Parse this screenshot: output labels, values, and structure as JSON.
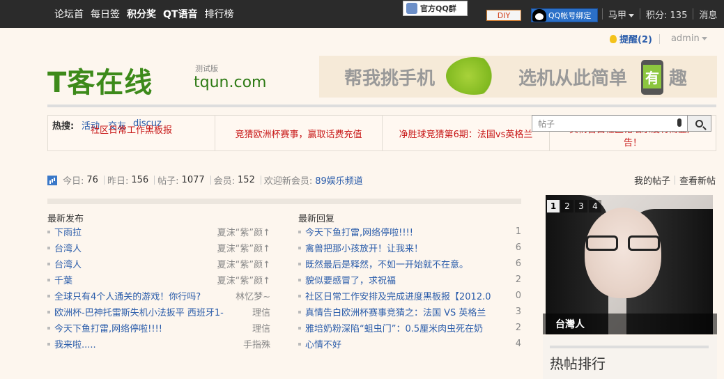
{
  "topnav": {
    "items": [
      {
        "label": "论坛首",
        "bold": false
      },
      {
        "label": "每日签",
        "bold": false
      },
      {
        "label": "积分奖",
        "bold": true
      },
      {
        "label": "QT语音",
        "bold": true
      },
      {
        "label": "排行榜",
        "bold": false
      }
    ],
    "qq_group": "官方QQ群",
    "diy": "DIY",
    "qq_bind": "QQ帐号绑定",
    "user": "马甲",
    "points_label": "积分: 135",
    "messages": "消息"
  },
  "remind": {
    "label": "提醒",
    "count": "(2)",
    "admin": "admin"
  },
  "logo": {
    "main": "T客在线",
    "beta": "测试版",
    "domain": "tqun.com"
  },
  "banner": {
    "left": "帮我挑手机",
    "right": "选机从此简单",
    "highlight": "有",
    "end": "趣"
  },
  "hotbar": {
    "label": "热搜:",
    "keywords": [
      "活动",
      "交友",
      "discuz"
    ],
    "cells": [
      "社区日常工作黑板报",
      "竞猜欧洲杯赛事，赢取话费充值",
      "净胜球竞猜第6期：法国vs英格兰",
      "真情告白社区论坛永没有商业广告！"
    ],
    "search_placeholder": "帖子"
  },
  "stats": {
    "today_label": "今日:",
    "today": "76",
    "yesterday_label": "昨日:",
    "yesterday": "156",
    "posts_label": "帖子:",
    "posts": "1077",
    "members_label": "会员:",
    "members": "152",
    "welcome_label": "欢迎新会员:",
    "newest": "89娱乐频道",
    "my_posts": "我的帖子",
    "new_posts": "查看新帖"
  },
  "latest": {
    "title": "最新发布",
    "items": [
      {
        "title": "下雨拉",
        "author": "夏沫“紫”颜↑"
      },
      {
        "title": "台湾人",
        "author": "夏沫“紫”颜↑"
      },
      {
        "title": "台湾人",
        "author": "夏沫“紫”颜↑"
      },
      {
        "title": "千葉",
        "author": "夏沫“紫”颜↑"
      },
      {
        "title": "全球只有4个人通关的游戏！你行吗?",
        "author": "林忆梦~"
      },
      {
        "title": "欧洲杯-巴神托雷斯失机小法扳平 西班牙1-",
        "author": "理信"
      },
      {
        "title": "今天下鱼打雷,网络停啦!!!!",
        "author": "理信"
      },
      {
        "title": "我来啦.....",
        "author": "手指殊"
      }
    ]
  },
  "replies": {
    "title": "最新回复",
    "items": [
      {
        "title": "今天下鱼打雷,网络停啦!!!!",
        "count": "1"
      },
      {
        "title": "禽兽把那小孩放开！让我来！",
        "count": "6"
      },
      {
        "title": "既然最后是释然，不如一开始就不在意。",
        "count": "6"
      },
      {
        "title": "貌似要感冒了，求祝福",
        "count": "2"
      },
      {
        "title": "社区日常工作安排及完成进度黑板报【2012.0",
        "count": "0"
      },
      {
        "title": "真情告白欧洲杯赛事竞猜之：法国 VS 英格兰",
        "count": "3"
      },
      {
        "title": "雅培奶粉深陷“蛆虫门”：0.5厘米肉虫死在奶",
        "count": "2"
      },
      {
        "title": "心情不好",
        "count": "4"
      }
    ]
  },
  "slider": {
    "pages": [
      "1",
      "2",
      "3",
      "4"
    ],
    "active": "1",
    "caption": "台灣人"
  },
  "hotrank": {
    "title": "热帖排行"
  }
}
